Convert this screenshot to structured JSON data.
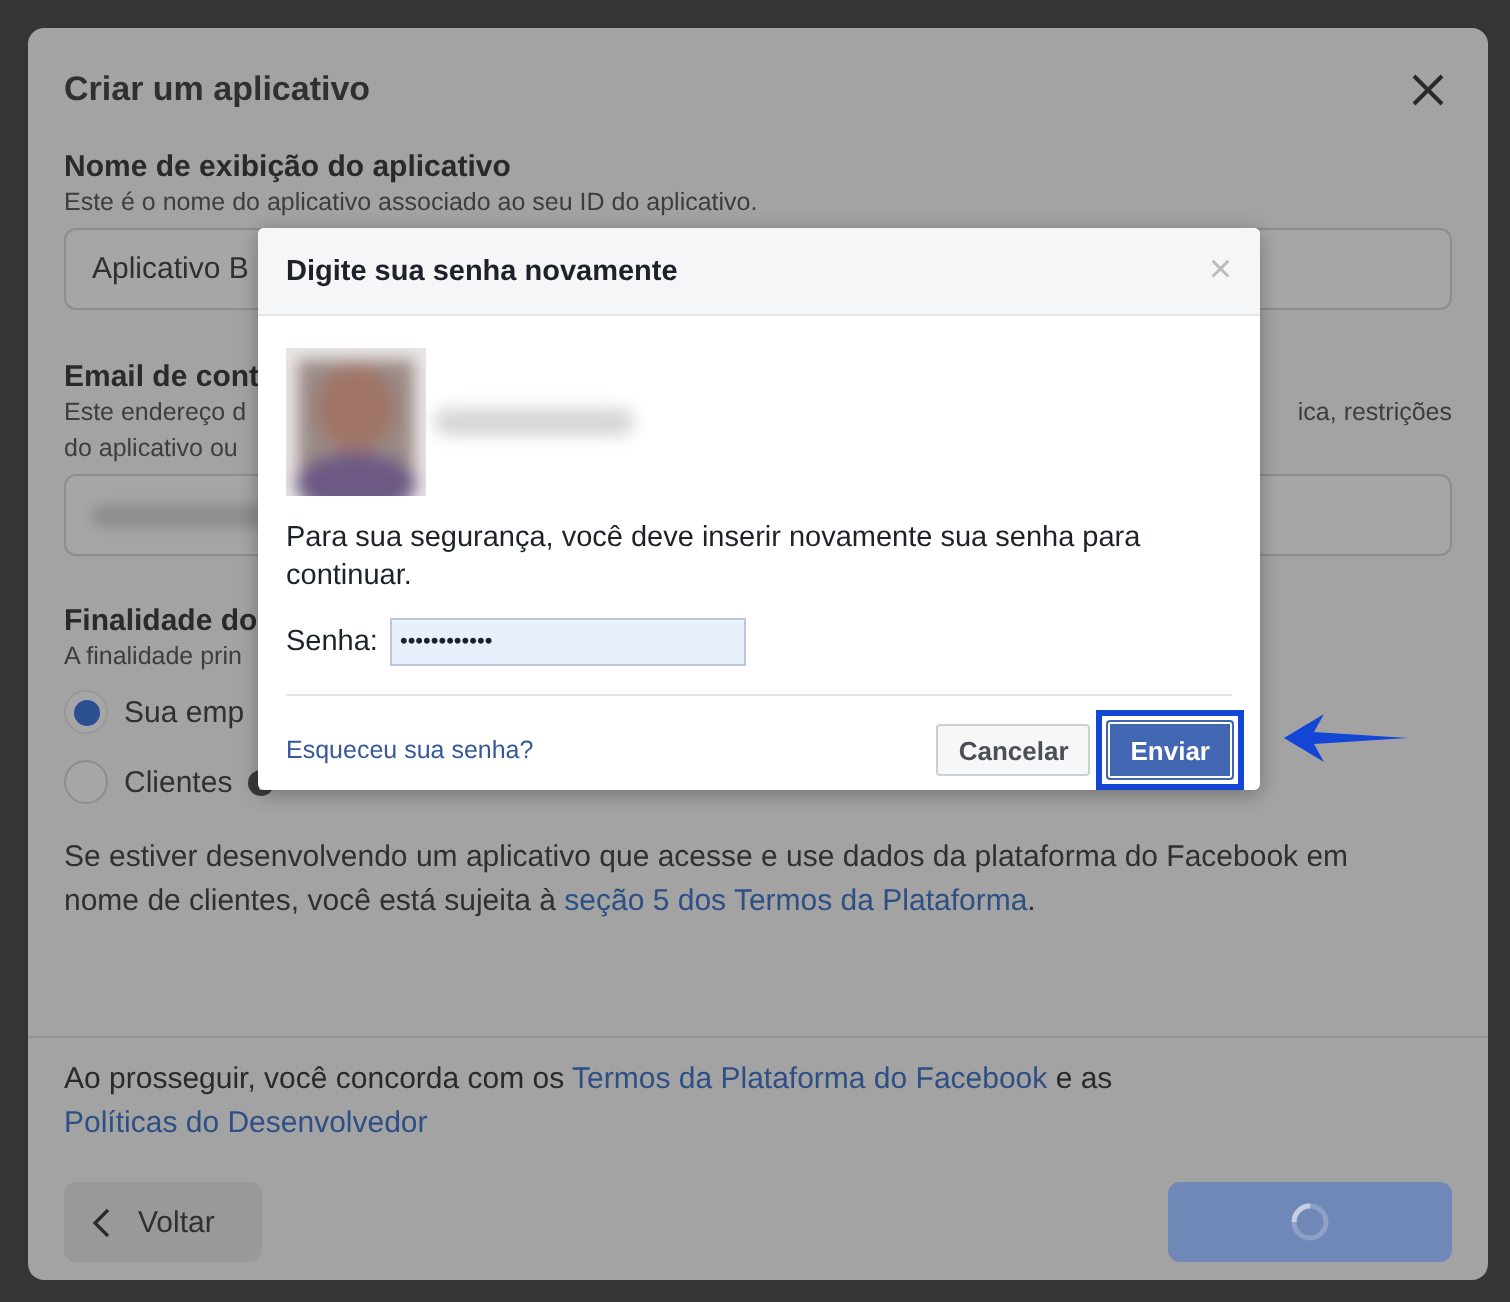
{
  "background_dialog": {
    "title": "Criar um aplicativo",
    "name_section": {
      "label": "Nome de exibição do aplicativo",
      "description": "Este é o nome do aplicativo associado ao seu ID do aplicativo.",
      "value": "Aplicativo B"
    },
    "email_section": {
      "label": "Email de cont",
      "description_lines": [
        "Este endereço d",
        "do aplicativo ou"
      ],
      "description_right": "ica, restrições"
    },
    "purpose_section": {
      "label": "Finalidade do",
      "description": "A finalidade prin",
      "options": [
        {
          "label": "Sua emp",
          "selected": true,
          "info": false
        },
        {
          "label": "Clientes",
          "selected": false,
          "info": true
        }
      ]
    },
    "notice": {
      "before": "Se estiver desenvolvendo um aplicativo que acesse e use dados da plataforma do Facebook em nome de clientes, você está sujeita à ",
      "link": "seção 5 dos Termos da Plataforma",
      "after": "."
    },
    "consent": {
      "before": "Ao prosseguir, você concorda com os ",
      "link1": "Termos da Plataforma do Facebook",
      "middle": " e as ",
      "link2": "Políticas do Desenvolvedor"
    },
    "back_button": "Voltar",
    "next_button": {
      "loading": true
    }
  },
  "password_dialog": {
    "title": "Digite sua senha novamente",
    "close": "×",
    "message": "Para sua segurança, você deve inserir novamente sua senha para continuar.",
    "password_label": "Senha:",
    "password_value": "••••••••••••",
    "forgot_link": "Esqueceu sua senha?",
    "cancel_button": "Cancelar",
    "submit_button": {
      "label": "Enviar",
      "highlighted": true
    }
  }
}
